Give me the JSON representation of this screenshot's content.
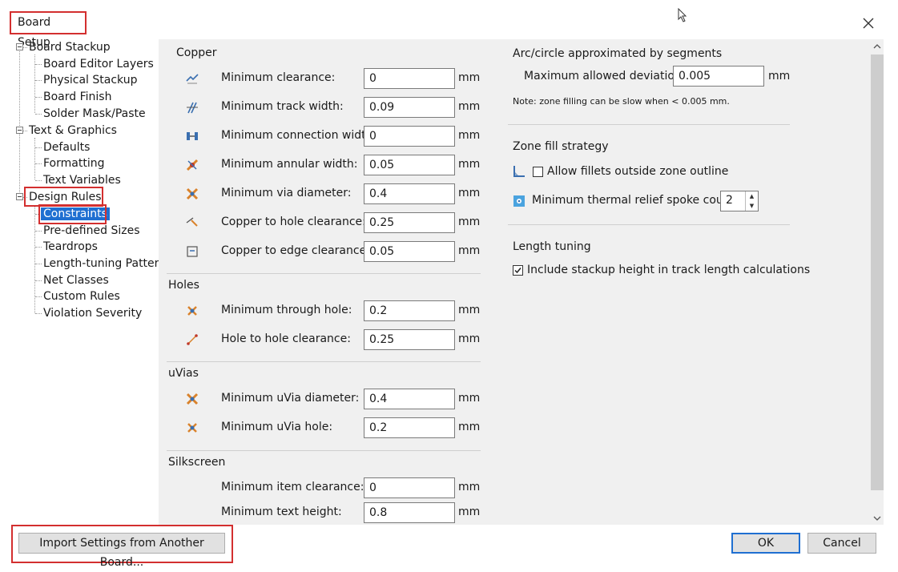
{
  "window": {
    "title": "Board Setup"
  },
  "tree": [
    {
      "label": "Board Stackup",
      "level": 0
    },
    {
      "label": "Board Editor Layers",
      "level": 1
    },
    {
      "label": "Physical Stackup",
      "level": 1
    },
    {
      "label": "Board Finish",
      "level": 1
    },
    {
      "label": "Solder Mask/Paste",
      "level": 1
    },
    {
      "label": "Text & Graphics",
      "level": 0
    },
    {
      "label": "Defaults",
      "level": 1
    },
    {
      "label": "Formatting",
      "level": 1
    },
    {
      "label": "Text Variables",
      "level": 1
    },
    {
      "label": "Design Rules",
      "level": 0
    },
    {
      "label": "Constraints",
      "level": 1
    },
    {
      "label": "Pre-defined Sizes",
      "level": 1
    },
    {
      "label": "Teardrops",
      "level": 1
    },
    {
      "label": "Length-tuning Patterns",
      "level": 1
    },
    {
      "label": "Net Classes",
      "level": 1
    },
    {
      "label": "Custom Rules",
      "level": 1
    },
    {
      "label": "Violation Severity",
      "level": 1
    }
  ],
  "copper": {
    "heading": "Copper",
    "rows": [
      {
        "label": "Minimum clearance:",
        "value": "0",
        "unit": "mm",
        "icon": "clearance-icon"
      },
      {
        "label": "Minimum track width:",
        "value": "0.09",
        "unit": "mm",
        "icon": "track-width-icon"
      },
      {
        "label": "Minimum connection width:",
        "value": "0",
        "unit": "mm",
        "icon": "connection-width-icon"
      },
      {
        "label": "Minimum annular width:",
        "value": "0.05",
        "unit": "mm",
        "icon": "annular-width-icon"
      },
      {
        "label": "Minimum via diameter:",
        "value": "0.4",
        "unit": "mm",
        "icon": "via-diameter-icon"
      },
      {
        "label": "Copper to hole clearance:",
        "value": "0.25",
        "unit": "mm",
        "icon": "hole-clearance-icon"
      },
      {
        "label": "Copper to edge clearance:",
        "value": "0.05",
        "unit": "mm",
        "icon": "edge-clearance-icon"
      }
    ]
  },
  "holes": {
    "heading": "Holes",
    "rows": [
      {
        "label": "Minimum through hole:",
        "value": "0.2",
        "unit": "mm",
        "icon": "through-hole-icon"
      },
      {
        "label": "Hole to hole clearance:",
        "value": "0.25",
        "unit": "mm",
        "icon": "hole-to-hole-icon"
      }
    ]
  },
  "uvias": {
    "heading": "uVias",
    "rows": [
      {
        "label": "Minimum uVia diameter:",
        "value": "0.4",
        "unit": "mm",
        "icon": "uvia-diameter-icon"
      },
      {
        "label": "Minimum uVia hole:",
        "value": "0.2",
        "unit": "mm",
        "icon": "uvia-hole-icon"
      }
    ]
  },
  "silkscreen": {
    "heading": "Silkscreen",
    "rows": [
      {
        "label": "Minimum item clearance:",
        "value": "0",
        "unit": "mm"
      },
      {
        "label": "Minimum text height:",
        "value": "0.8",
        "unit": "mm"
      }
    ]
  },
  "arc": {
    "heading": "Arc/circle approximated by segments",
    "label": "Maximum allowed deviation:",
    "value": "0.005",
    "unit": "mm",
    "note": "Note: zone filling can be slow when < 0.005 mm."
  },
  "zone": {
    "heading": "Zone fill strategy",
    "fillets_label": "Allow fillets outside zone outline",
    "fillets_checked": false,
    "spoke_label": "Minimum thermal relief spoke count:",
    "spoke_value": "2"
  },
  "length": {
    "heading": "Length tuning",
    "stackup_label": "Include stackup height in track length calculations",
    "stackup_checked": true
  },
  "buttons": {
    "import": "Import Settings from Another Board...",
    "ok": "OK",
    "cancel": "Cancel"
  }
}
